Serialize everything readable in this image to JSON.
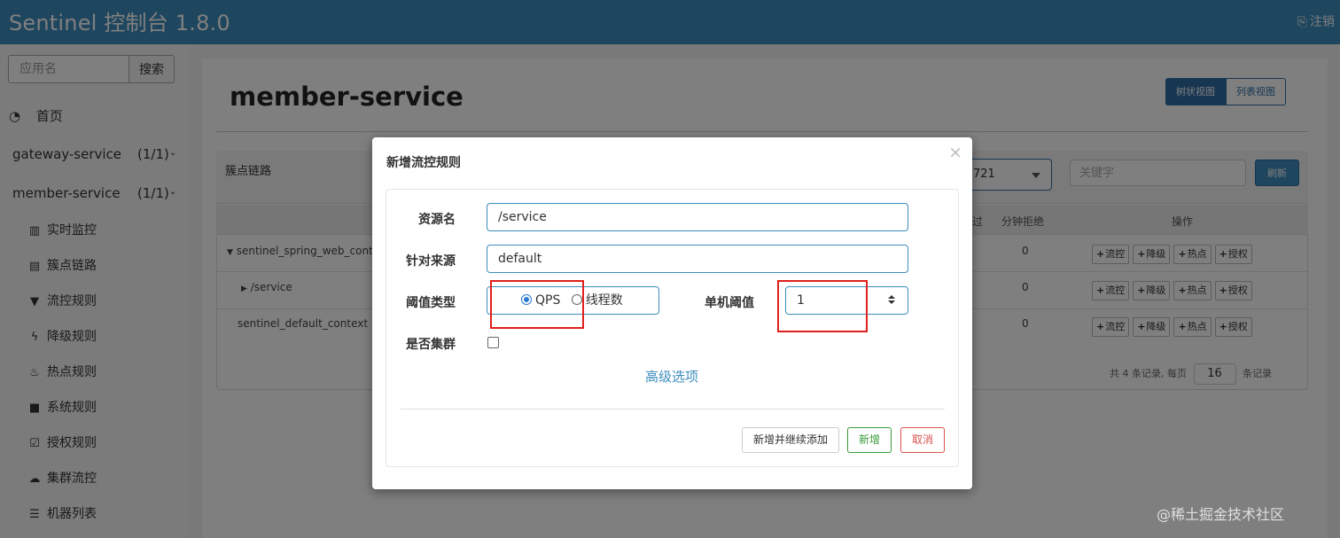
{
  "header": {
    "brand": "Sentinel 控制台 1.8.0",
    "logout": "注销"
  },
  "sidebar": {
    "search_placeholder": "应用名",
    "search_button": "搜索",
    "home": "首页",
    "apps": [
      {
        "name": "gateway-service",
        "count": "(1/1)"
      },
      {
        "name": "member-service",
        "count": "(1/1)"
      }
    ],
    "subitems": [
      "实时监控",
      "簇点链路",
      "流控规则",
      "降级规则",
      "热点规则",
      "系统规则",
      "授权规则",
      "集群流控",
      "机器列表"
    ]
  },
  "main": {
    "title": "member-service",
    "view_tree": "树状视图",
    "view_list": "列表视图",
    "panel_title": "簇点链路",
    "machine_value": "721",
    "keyword_placeholder": "关键字",
    "refresh": "刷新",
    "columns": {
      "pass": "过",
      "block_per_min": "分钟拒绝",
      "ops": "操作"
    },
    "rows": [
      {
        "name": "sentinel_spring_web_contex",
        "block": "0"
      },
      {
        "name": "/service",
        "block": "0"
      },
      {
        "name": "sentinel_default_context",
        "block": "0"
      }
    ],
    "op_buttons": [
      "流控",
      "降级",
      "热点",
      "授权"
    ],
    "pager": {
      "prefix": "共 4 条记录, 每页",
      "page_size": "16",
      "suffix": "条记录"
    }
  },
  "modal": {
    "title": "新增流控规则",
    "resource_label": "资源名",
    "resource_value": "/service",
    "source_label": "针对来源",
    "source_value": "default",
    "threshold_type_label": "阈值类型",
    "radio_qps": "QPS",
    "radio_threads": "线程数",
    "single_threshold_label": "单机阈值",
    "single_threshold_value": "1",
    "cluster_label": "是否集群",
    "advanced": "高级选项",
    "btn_add_continue": "新增并继续添加",
    "btn_add": "新增",
    "btn_cancel": "取消"
  },
  "watermark": "@稀土掘金技术社区",
  "colors": {
    "primary": "#3c8dbc",
    "success": "#3a9c3a",
    "danger": "#d9534f",
    "highlight": "#e0201a"
  }
}
